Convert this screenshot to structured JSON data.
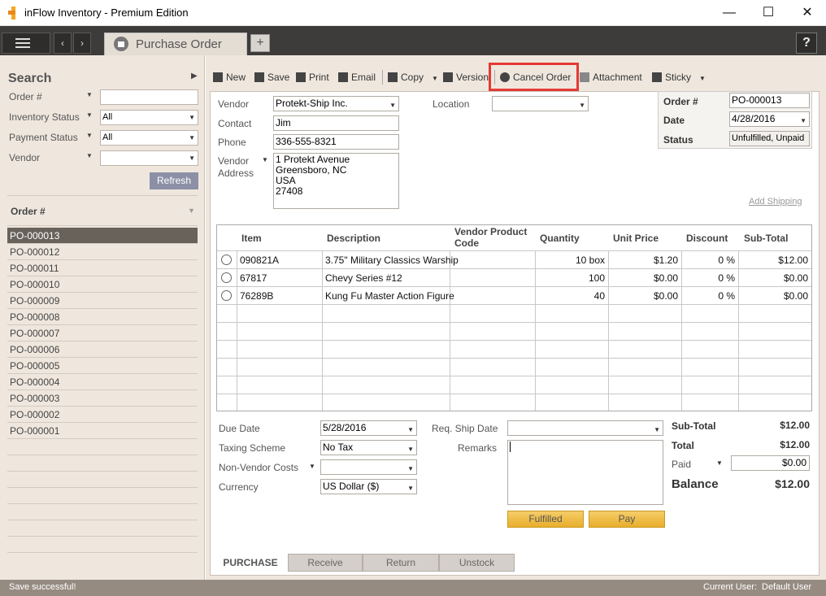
{
  "window": {
    "title": "inFlow Inventory - Premium Edition",
    "minimize": "—",
    "maximize": "☐",
    "close": "✕"
  },
  "topbar": {
    "tab_label": "Purchase Order",
    "add_tab": "+",
    "help": "?"
  },
  "search": {
    "title": "Search",
    "fields": [
      {
        "label": "Order #",
        "value": ""
      },
      {
        "label": "Inventory Status",
        "value": "All"
      },
      {
        "label": "Payment Status",
        "value": "All"
      },
      {
        "label": "Vendor",
        "value": ""
      }
    ],
    "refresh": "Refresh"
  },
  "order_list": {
    "header": "Order #",
    "items": [
      "PO-000013",
      "PO-000012",
      "PO-000011",
      "PO-000010",
      "PO-000009",
      "PO-000008",
      "PO-000007",
      "PO-000006",
      "PO-000005",
      "PO-000004",
      "PO-000003",
      "PO-000002",
      "PO-000001"
    ],
    "selected": "PO-000013"
  },
  "toolbar": {
    "new": "New",
    "save": "Save",
    "print": "Print",
    "email": "Email",
    "copy": "Copy",
    "version": "Version",
    "cancel_order": "Cancel Order",
    "attachment": "Attachment",
    "sticky": "Sticky"
  },
  "vendor": {
    "vendor_label": "Vendor",
    "vendor": "Protekt-Ship Inc.",
    "contact_label": "Contact",
    "contact": "Jim",
    "phone_label": "Phone",
    "phone": "336-555-8321",
    "address_label1": "Vendor",
    "address_label2": "Address",
    "address": [
      "1 Protekt Avenue",
      "Greensboro, NC",
      "USA",
      "27408"
    ],
    "location_label": "Location",
    "location": ""
  },
  "order_info": {
    "order_label": "Order #",
    "order": "PO-000013",
    "date_label": "Date",
    "date": "4/28/2016",
    "status_label": "Status",
    "status": "Unfulfilled, Unpaid",
    "add_shipping": "Add Shipping"
  },
  "grid": {
    "headers": {
      "item": "Item",
      "description": "Description",
      "vpc1": "Vendor Product",
      "vpc2": "Code",
      "quantity": "Quantity",
      "unit_price": "Unit Price",
      "discount": "Discount",
      "subtotal": "Sub-Total"
    },
    "rows": [
      {
        "item": "090821A",
        "description": "3.75\" Military Classics Warship",
        "vpc": "",
        "quantity": "10 box",
        "unit_price": "$1.20",
        "discount": "0 %",
        "subtotal": "$12.00"
      },
      {
        "item": "67817",
        "description": "Chevy Series #12",
        "vpc": "",
        "quantity": "100",
        "unit_price": "$0.00",
        "discount": "0 %",
        "subtotal": "$0.00"
      },
      {
        "item": "76289B",
        "description": "Kung Fu Master Action Figure",
        "vpc": "",
        "quantity": "40",
        "unit_price": "$0.00",
        "discount": "0 %",
        "subtotal": "$0.00"
      }
    ]
  },
  "bottom": {
    "due_date_label": "Due Date",
    "due_date": "5/28/2016",
    "taxing_label": "Taxing Scheme",
    "taxing": "No Tax",
    "nonvendor_label": "Non-Vendor Costs",
    "nonvendor": "",
    "currency_label": "Currency",
    "currency": "US Dollar ($)",
    "req_ship_label": "Req. Ship Date",
    "req_ship": "",
    "remarks_label": "Remarks",
    "remarks": "",
    "fulfilled": "Fulfilled",
    "pay": "Pay"
  },
  "totals": {
    "subtotal_label": "Sub-Total",
    "subtotal": "$12.00",
    "total_label": "Total",
    "total": "$12.00",
    "paid_label": "Paid",
    "paid": "$0.00",
    "balance_label": "Balance",
    "balance": "$12.00"
  },
  "tabs": [
    "PURCHASE",
    "Receive",
    "Return",
    "Unstock"
  ],
  "status": {
    "message": "Save successful!",
    "user_label": "Current User:",
    "user": "Default User"
  }
}
